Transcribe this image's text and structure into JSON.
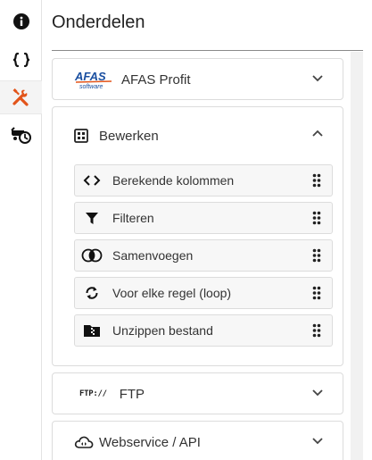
{
  "page": {
    "title": "Onderdelen"
  },
  "rail": {
    "items": [
      {
        "icon": "info-icon"
      },
      {
        "icon": "braces-icon"
      },
      {
        "icon": "tools-icon",
        "active": true
      },
      {
        "icon": "scheduled-run-icon"
      }
    ]
  },
  "sections": {
    "afas": {
      "label": "AFAS Profit",
      "logo_top": "AFAS",
      "logo_bottom": "software"
    },
    "bewerken": {
      "label": "Bewerken",
      "items": [
        {
          "label": "Berekende kolommen",
          "icon": "code-brackets-icon"
        },
        {
          "label": "Filteren",
          "icon": "filter-icon"
        },
        {
          "label": "Samenvoegen",
          "icon": "merge-circles-icon"
        },
        {
          "label": "Voor elke regel (loop)",
          "icon": "loop-arrows-icon"
        },
        {
          "label": "Unzippen bestand",
          "icon": "zip-folder-icon"
        }
      ]
    },
    "ftp": {
      "label": "FTP",
      "badge": "FTP://"
    },
    "webservice": {
      "label": "Webservice / API"
    }
  },
  "colors": {
    "accent": "#e2541a",
    "text": "#333333",
    "border": "#dcdcdc"
  }
}
